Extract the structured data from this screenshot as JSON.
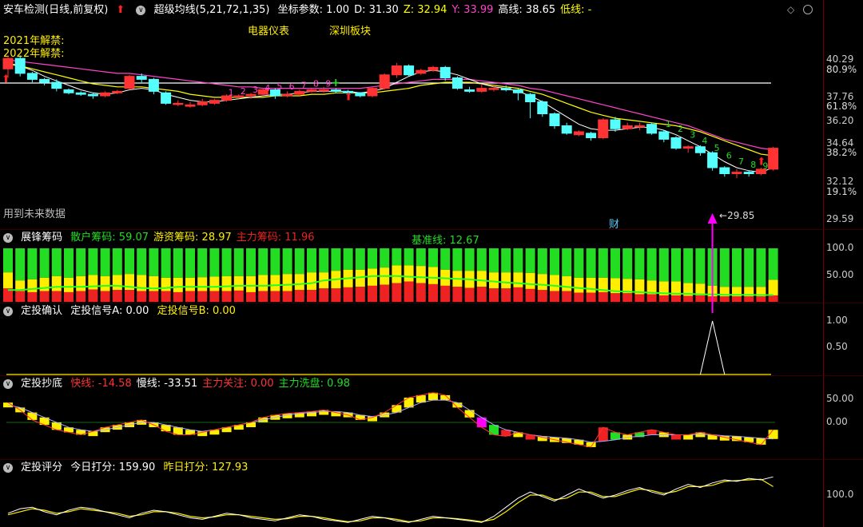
{
  "colors": {
    "up": "#ff3333",
    "down": "#55ffff",
    "ma1": "#ffffff",
    "ma2": "#ffff00",
    "ma3": "#ff44cc",
    "yellow": "#ffee00",
    "green": "#22dd22",
    "red": "#ee2222",
    "magenta": "#ff00ff"
  },
  "panel1": {
    "title": "安车检测(日线,前复权)",
    "indicator": "超级均线(5,21,72,1,35)",
    "params": [
      {
        "label": "坐标参数: 1.00",
        "color": "#ffffff"
      },
      {
        "label": "D: 31.30",
        "color": "#ffffff"
      },
      {
        "label": "Z: 32.94",
        "color": "#ffff00"
      },
      {
        "label": "Y: 33.99",
        "color": "#ff44cc"
      },
      {
        "label": "高线: 38.65",
        "color": "#ffffff"
      },
      {
        "label": "低线: -",
        "color": "#ffff00"
      }
    ],
    "sector1": "电器仪表",
    "sector2": "深圳板块",
    "note1": "2021年解禁:",
    "note2": "2022年解禁:",
    "future_note": "用到未来数据",
    "finance_marker": "财",
    "low_marker": "29.85",
    "counts_a": [
      "1",
      "2",
      "3",
      "4",
      "5",
      "6",
      "7",
      "8",
      "9"
    ],
    "counts_b": [
      "1",
      "2",
      "3",
      "4",
      "5",
      "6",
      "7",
      "8",
      "9"
    ],
    "yticks": [
      "40.29",
      "80.9%",
      "37.76",
      "61.8%",
      "36.20",
      "34.64",
      "38.2%",
      "32.12",
      "19.1%",
      "29.59"
    ]
  },
  "panel2": {
    "title": "展锋筹码",
    "labels": [
      {
        "text": "散户筹码: 59.07",
        "color": "#22dd22"
      },
      {
        "text": "游资筹码: 28.97",
        "color": "#ffee00"
      },
      {
        "text": "主力筹码: 11.96",
        "color": "#ee2222"
      }
    ],
    "baseline_label": "基准线: 12.67",
    "yticks": [
      "100.0",
      "50.00"
    ]
  },
  "panel3": {
    "title": "定投确认",
    "labelA": "定投信号A: 0.00",
    "labelB": "定投信号B: 0.00",
    "yticks": [
      "1.00",
      "0.50"
    ]
  },
  "panel4": {
    "title": "定投抄底",
    "labels": [
      {
        "text": "快线: -14.58",
        "color": "#ff3333"
      },
      {
        "text": "慢线: -33.51",
        "color": "#ffffff"
      },
      {
        "text": "主力关注: 0.00",
        "color": "#ff3333"
      },
      {
        "text": "主力洗盘: 0.98",
        "color": "#22dd22"
      }
    ],
    "yticks": [
      "50.00",
      "0.00"
    ]
  },
  "panel5": {
    "title": "定投评分",
    "today": "今日打分: 159.90",
    "yesterday": "昨日打分: 127.93",
    "yticks": [
      "100.0"
    ]
  },
  "chart_data": {
    "type": "candlestick",
    "price_range": [
      29.0,
      41.0
    ],
    "candles": [
      [
        39.6,
        40.3,
        39.0,
        40.5
      ],
      [
        40.3,
        39.3,
        39.1,
        40.5
      ],
      [
        39.3,
        38.9,
        38.7,
        39.4
      ],
      [
        38.9,
        38.7,
        38.5,
        39.0
      ],
      [
        38.7,
        38.3,
        38.1,
        38.9
      ],
      [
        38.2,
        38.0,
        37.9,
        38.3
      ],
      [
        38.0,
        37.9,
        37.8,
        38.1
      ],
      [
        37.9,
        37.8,
        37.6,
        38.0
      ],
      [
        37.8,
        38.0,
        37.7,
        38.1
      ],
      [
        38.0,
        38.1,
        37.9,
        38.2
      ],
      [
        38.3,
        39.1,
        38.2,
        39.2
      ],
      [
        39.1,
        38.9,
        38.7,
        39.3
      ],
      [
        38.9,
        38.1,
        37.9,
        39.0
      ],
      [
        38.0,
        37.3,
        37.2,
        38.1
      ],
      [
        37.3,
        37.3,
        37.1,
        37.5
      ],
      [
        37.1,
        37.2,
        37.0,
        37.4
      ],
      [
        37.2,
        37.4,
        37.1,
        37.6
      ],
      [
        37.3,
        37.5,
        37.2,
        37.6
      ],
      [
        37.5,
        37.8,
        37.4,
        37.9
      ],
      [
        37.8,
        37.8,
        37.6,
        37.9
      ],
      [
        37.8,
        37.9,
        37.6,
        38.0
      ],
      [
        37.9,
        38.2,
        37.8,
        38.3
      ],
      [
        38.2,
        37.8,
        37.6,
        38.3
      ],
      [
        37.8,
        37.9,
        37.7,
        38.1
      ],
      [
        37.9,
        38.1,
        37.8,
        38.2
      ],
      [
        38.1,
        38.2,
        38.0,
        38.3
      ],
      [
        38.2,
        38.2,
        38.0,
        38.4
      ],
      [
        38.2,
        38.1,
        38.0,
        38.3
      ],
      [
        38.1,
        38.0,
        37.9,
        38.2
      ],
      [
        38.0,
        37.8,
        37.7,
        38.0
      ],
      [
        37.8,
        38.3,
        37.7,
        38.4
      ],
      [
        38.3,
        39.2,
        38.2,
        39.3
      ],
      [
        39.2,
        39.8,
        39.0,
        40.0
      ],
      [
        39.8,
        39.2,
        39.1,
        39.9
      ],
      [
        39.3,
        39.5,
        39.2,
        39.6
      ],
      [
        39.5,
        39.7,
        39.4,
        39.8
      ],
      [
        39.7,
        39.0,
        38.8,
        39.8
      ],
      [
        39.0,
        38.3,
        38.2,
        39.1
      ],
      [
        38.2,
        38.1,
        38.0,
        38.4
      ],
      [
        38.1,
        38.3,
        38.0,
        38.6
      ],
      [
        38.3,
        38.3,
        38.1,
        38.5
      ],
      [
        38.3,
        38.2,
        38.1,
        38.5
      ],
      [
        38.2,
        38.0,
        37.5,
        38.3
      ],
      [
        37.9,
        37.4,
        36.3,
        38.0
      ],
      [
        37.4,
        36.6,
        36.4,
        37.5
      ],
      [
        36.6,
        35.8,
        35.6,
        36.7
      ],
      [
        35.8,
        35.3,
        35.2,
        36.0
      ],
      [
        35.2,
        35.4,
        35.1,
        35.5
      ],
      [
        35.3,
        35.0,
        34.8,
        35.4
      ],
      [
        35.0,
        36.2,
        34.9,
        36.3
      ],
      [
        36.2,
        35.6,
        35.4,
        36.4
      ],
      [
        35.6,
        35.8,
        35.5,
        36.0
      ],
      [
        35.8,
        35.8,
        35.5,
        36.0
      ],
      [
        35.9,
        35.3,
        35.2,
        36.0
      ],
      [
        35.4,
        34.9,
        34.7,
        35.5
      ],
      [
        35.0,
        34.3,
        34.2,
        35.1
      ],
      [
        34.3,
        34.4,
        34.0,
        34.5
      ],
      [
        34.4,
        34.0,
        33.8,
        34.5
      ],
      [
        34.0,
        33.0,
        32.8,
        34.1
      ],
      [
        33.0,
        32.6,
        32.4,
        33.1
      ],
      [
        32.6,
        32.7,
        32.3,
        32.9
      ],
      [
        32.7,
        32.6,
        32.4,
        32.8
      ],
      [
        32.6,
        32.9,
        32.5,
        33.0
      ],
      [
        32.9,
        34.3,
        32.8,
        34.4
      ]
    ],
    "ma_fast": [
      40.0,
      39.8,
      39.5,
      39.1,
      38.8,
      38.5,
      38.2,
      38.0,
      37.9,
      38.0,
      38.2,
      38.3,
      38.2,
      37.9,
      37.7,
      37.5,
      37.4,
      37.4,
      37.5,
      37.6,
      37.7,
      37.8,
      37.9,
      37.9,
      38.0,
      38.1,
      38.1,
      38.1,
      38.1,
      38.0,
      38.1,
      38.3,
      38.7,
      39.1,
      39.4,
      39.5,
      39.4,
      39.2,
      38.9,
      38.6,
      38.4,
      38.3,
      38.1,
      37.8,
      37.4,
      36.9,
      36.4,
      35.9,
      35.6,
      35.5,
      35.5,
      35.6,
      35.7,
      35.7,
      35.5,
      35.2,
      34.8,
      34.4,
      33.9,
      33.4,
      33.0,
      32.8,
      32.7,
      33.0
    ],
    "ma_mid": [
      39.9,
      39.8,
      39.6,
      39.4,
      39.2,
      39.0,
      38.8,
      38.6,
      38.5,
      38.4,
      38.4,
      38.4,
      38.3,
      38.2,
      38.1,
      37.9,
      37.8,
      37.7,
      37.7,
      37.7,
      37.7,
      37.7,
      37.8,
      37.8,
      37.8,
      37.9,
      37.9,
      38.0,
      38.0,
      38.0,
      38.0,
      38.1,
      38.2,
      38.3,
      38.5,
      38.6,
      38.7,
      38.7,
      38.7,
      38.6,
      38.5,
      38.4,
      38.3,
      38.1,
      37.9,
      37.6,
      37.3,
      37.0,
      36.7,
      36.5,
      36.3,
      36.2,
      36.1,
      36.0,
      35.9,
      35.8,
      35.6,
      35.4,
      35.1,
      34.8,
      34.5,
      34.2,
      33.9,
      33.8
    ],
    "ma_slow": [
      40.2,
      40.1,
      40.0,
      39.9,
      39.8,
      39.7,
      39.6,
      39.5,
      39.4,
      39.3,
      39.3,
      39.2,
      39.1,
      39.0,
      38.9,
      38.8,
      38.7,
      38.6,
      38.5,
      38.4,
      38.4,
      38.3,
      38.3,
      38.3,
      38.3,
      38.3,
      38.3,
      38.3,
      38.3,
      38.3,
      38.4,
      38.5,
      38.6,
      38.7,
      38.8,
      38.9,
      38.9,
      38.9,
      38.9,
      38.8,
      38.7,
      38.6,
      38.5,
      38.3,
      38.2,
      38.0,
      37.8,
      37.6,
      37.4,
      37.2,
      37.0,
      36.8,
      36.6,
      36.4,
      36.2,
      36.0,
      35.8,
      35.5,
      35.2,
      34.9,
      34.7,
      34.5,
      34.3,
      34.2
    ],
    "chips": [
      [
        45,
        30,
        25
      ],
      [
        60,
        20,
        20
      ],
      [
        58,
        24,
        18
      ],
      [
        55,
        25,
        20
      ],
      [
        52,
        28,
        20
      ],
      [
        55,
        27,
        18
      ],
      [
        52,
        28,
        20
      ],
      [
        50,
        27,
        23
      ],
      [
        52,
        28,
        20
      ],
      [
        50,
        28,
        22
      ],
      [
        48,
        30,
        22
      ],
      [
        50,
        30,
        20
      ],
      [
        52,
        28,
        20
      ],
      [
        55,
        25,
        20
      ],
      [
        55,
        27,
        18
      ],
      [
        55,
        25,
        20
      ],
      [
        54,
        26,
        20
      ],
      [
        53,
        27,
        20
      ],
      [
        52,
        28,
        20
      ],
      [
        52,
        27,
        21
      ],
      [
        52,
        30,
        18
      ],
      [
        50,
        30,
        20
      ],
      [
        50,
        30,
        20
      ],
      [
        48,
        32,
        20
      ],
      [
        48,
        30,
        22
      ],
      [
        45,
        33,
        22
      ],
      [
        45,
        30,
        25
      ],
      [
        42,
        33,
        25
      ],
      [
        40,
        33,
        27
      ],
      [
        40,
        32,
        28
      ],
      [
        38,
        32,
        30
      ],
      [
        36,
        32,
        32
      ],
      [
        32,
        33,
        35
      ],
      [
        32,
        30,
        38
      ],
      [
        33,
        32,
        35
      ],
      [
        35,
        32,
        33
      ],
      [
        40,
        30,
        30
      ],
      [
        42,
        30,
        28
      ],
      [
        42,
        32,
        26
      ],
      [
        42,
        30,
        28
      ],
      [
        45,
        30,
        25
      ],
      [
        45,
        30,
        25
      ],
      [
        45,
        28,
        27
      ],
      [
        46,
        30,
        24
      ],
      [
        48,
        30,
        22
      ],
      [
        50,
        30,
        20
      ],
      [
        52,
        28,
        20
      ],
      [
        55,
        28,
        17
      ],
      [
        55,
        28,
        17
      ],
      [
        55,
        27,
        18
      ],
      [
        56,
        28,
        16
      ],
      [
        57,
        27,
        16
      ],
      [
        58,
        28,
        14
      ],
      [
        60,
        26,
        14
      ],
      [
        62,
        26,
        12
      ],
      [
        62,
        26,
        12
      ],
      [
        65,
        24,
        11
      ],
      [
        66,
        22,
        12
      ],
      [
        70,
        20,
        10
      ],
      [
        72,
        18,
        10
      ],
      [
        72,
        18,
        10
      ],
      [
        72,
        18,
        10
      ],
      [
        72,
        18,
        10
      ],
      [
        59,
        29,
        12
      ]
    ],
    "chip_baseline": [
      22,
      22,
      24,
      26,
      28,
      28,
      28,
      29,
      30,
      30,
      28,
      26,
      25,
      26,
      28,
      28,
      28,
      28,
      29,
      30,
      30,
      30,
      31,
      32,
      33,
      35,
      40,
      42,
      44,
      46,
      48,
      48,
      48,
      47,
      46,
      45,
      44,
      43,
      42,
      40,
      38,
      36,
      35,
      33,
      32,
      30,
      28,
      26,
      24,
      22,
      20,
      19,
      18,
      17,
      16,
      15,
      15,
      14,
      14,
      13,
      13,
      13,
      12.7,
      12.7
    ],
    "fast": [
      40,
      25,
      5,
      -5,
      -15,
      -20,
      -25,
      -18,
      -10,
      -5,
      0,
      5,
      -5,
      -18,
      -25,
      -25,
      -20,
      -15,
      -10,
      -5,
      0,
      10,
      15,
      18,
      20,
      22,
      25,
      20,
      15,
      5,
      10,
      20,
      35,
      50,
      55,
      60,
      55,
      30,
      10,
      -10,
      -25,
      -28,
      -20,
      -25,
      -30,
      -35,
      -40,
      -45,
      -50,
      -10,
      -20,
      -25,
      -20,
      -15,
      -20,
      -25,
      -25,
      -20,
      -25,
      -30,
      -35,
      -40,
      -45,
      -15
    ],
    "slow": [
      35,
      30,
      20,
      10,
      0,
      -10,
      -15,
      -18,
      -15,
      -10,
      -5,
      0,
      0,
      -5,
      -10,
      -15,
      -18,
      -15,
      -10,
      -5,
      0,
      5,
      10,
      15,
      18,
      20,
      22,
      22,
      20,
      15,
      12,
      15,
      20,
      30,
      40,
      45,
      45,
      40,
      25,
      10,
      -5,
      -15,
      -20,
      -25,
      -28,
      -30,
      -32,
      -35,
      -40,
      -38,
      -35,
      -30,
      -28,
      -25,
      -25,
      -25,
      -25,
      -24,
      -25,
      -27,
      -28,
      -30,
      -32,
      -33.5
    ],
    "score_today": [
      40,
      55,
      60,
      45,
      35,
      50,
      60,
      55,
      45,
      35,
      25,
      40,
      50,
      45,
      35,
      25,
      20,
      30,
      40,
      35,
      25,
      20,
      15,
      25,
      35,
      30,
      20,
      15,
      10,
      20,
      30,
      25,
      15,
      10,
      20,
      30,
      25,
      20,
      15,
      10,
      30,
      60,
      90,
      110,
      95,
      80,
      100,
      120,
      105,
      90,
      100,
      115,
      125,
      110,
      100,
      120,
      135,
      125,
      140,
      150,
      145,
      155,
      150,
      160
    ],
    "score_yest": [
      35,
      45,
      55,
      50,
      40,
      45,
      55,
      50,
      45,
      40,
      30,
      35,
      45,
      45,
      40,
      30,
      25,
      28,
      35,
      35,
      30,
      25,
      20,
      22,
      30,
      30,
      25,
      18,
      12,
      15,
      25,
      25,
      20,
      12,
      15,
      25,
      25,
      22,
      18,
      12,
      20,
      45,
      75,
      100,
      100,
      85,
      90,
      110,
      110,
      95,
      95,
      108,
      120,
      115,
      105,
      112,
      128,
      128,
      132,
      145,
      148,
      150,
      152,
      128
    ]
  }
}
